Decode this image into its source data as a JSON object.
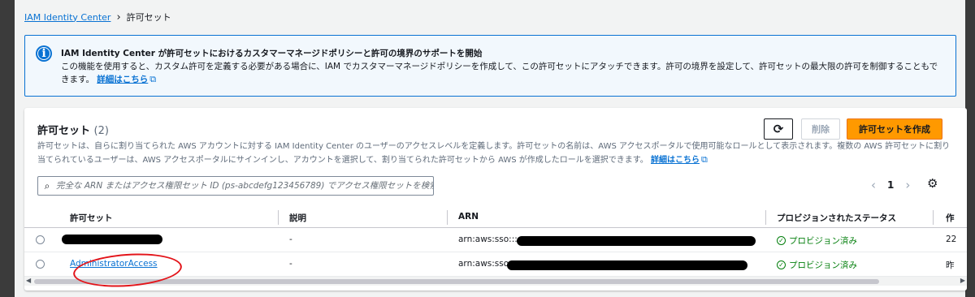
{
  "breadcrumb": {
    "root": "IAM Identity Center",
    "separator": "›",
    "current": "許可セット"
  },
  "alert": {
    "icon": "info-icon",
    "title": "IAM Identity Center が許可セットにおけるカスタマーマネージドポリシーと許可の境界のサポートを開始",
    "body": "この機能を使用すると、カスタム許可を定義する必要がある場合に、IAM でカスタマーマネージドポリシーを作成して、この許可セットにアタッチできます。許可の境界を設定して、許可セットの最大限の許可を制御することもできます。",
    "link": "詳細はこちら"
  },
  "panel": {
    "title": "許可セット",
    "count": "(2)",
    "description": "許可セットは、自らに割り当てられた AWS アカウントに対する IAM Identity Center のユーザーのアクセスレベルを定義します。許可セットの名前は、AWS アクセスポータルで使用可能なロールとして表示されます。複数の AWS 許可セットに割り当てられているユーザーは、AWS アクセスポータルにサインインし、アカウントを選択して、割り当てられた許可セットから AWS が作成したロールを選択できます。",
    "link": "詳細はこちら",
    "buttons": {
      "refresh": "⟳",
      "delete": "削除",
      "create": "許可セットを作成"
    },
    "search": {
      "placeholder": "完全な ARN またはアクセス権限セット ID (ps-abcdefg123456789) でアクセス権限セットを検索。"
    },
    "pagination": {
      "prev": "‹",
      "page": "1",
      "next": "›"
    }
  },
  "table": {
    "columns": [
      "許可セット",
      "説明",
      "ARN",
      "プロビジョンされたステータス",
      "作"
    ],
    "rows": [
      {
        "name": "",
        "description": "-",
        "arn": "arn:aws:sso:::",
        "status": "プロビジョン済み",
        "extra": "22"
      },
      {
        "name": "AdministratorAccess",
        "description": "-",
        "arn": "arn:aws:sso:::",
        "status": "プロビジョン済み",
        "extra": "昨"
      }
    ]
  },
  "colors": {
    "link": "#0972d3",
    "primary": "#ff9900",
    "success": "#037f0c",
    "annotation": "#e3141a"
  }
}
